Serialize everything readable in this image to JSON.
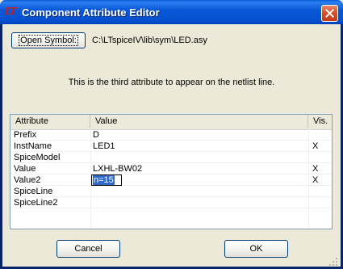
{
  "window": {
    "title": "Component Attribute Editor",
    "icon_text": "LT",
    "icon": "ltspice-logo-icon",
    "close_icon": "close-icon"
  },
  "toolbar": {
    "open_symbol_label": "Open Symbol:",
    "symbol_path": "C:\\LTspiceIV\\lib\\sym\\LED.asy"
  },
  "description": "This is the third attribute to appear on the netlist line.",
  "table": {
    "headers": [
      "Attribute",
      "Value",
      "Vis."
    ],
    "rows": [
      {
        "attribute": "Prefix",
        "value": "D",
        "vis": ""
      },
      {
        "attribute": "InstName",
        "value": "LED1",
        "vis": "X"
      },
      {
        "attribute": "SpiceModel",
        "value": "",
        "vis": ""
      },
      {
        "attribute": "Value",
        "value": "LXHL-BW02",
        "vis": "X"
      },
      {
        "attribute": "Value2",
        "value": "n=15",
        "vis": "X"
      },
      {
        "attribute": "SpiceLine",
        "value": "",
        "vis": ""
      },
      {
        "attribute": "SpiceLine2",
        "value": "",
        "vis": ""
      }
    ],
    "editing_row": 4
  },
  "buttons": {
    "cancel": "Cancel",
    "ok": "OK"
  },
  "colors": {
    "title_bar": "#0a58d8",
    "selection": "#316ac5",
    "close_button": "#d8502a",
    "dialog_bg": "#ece9d8"
  }
}
